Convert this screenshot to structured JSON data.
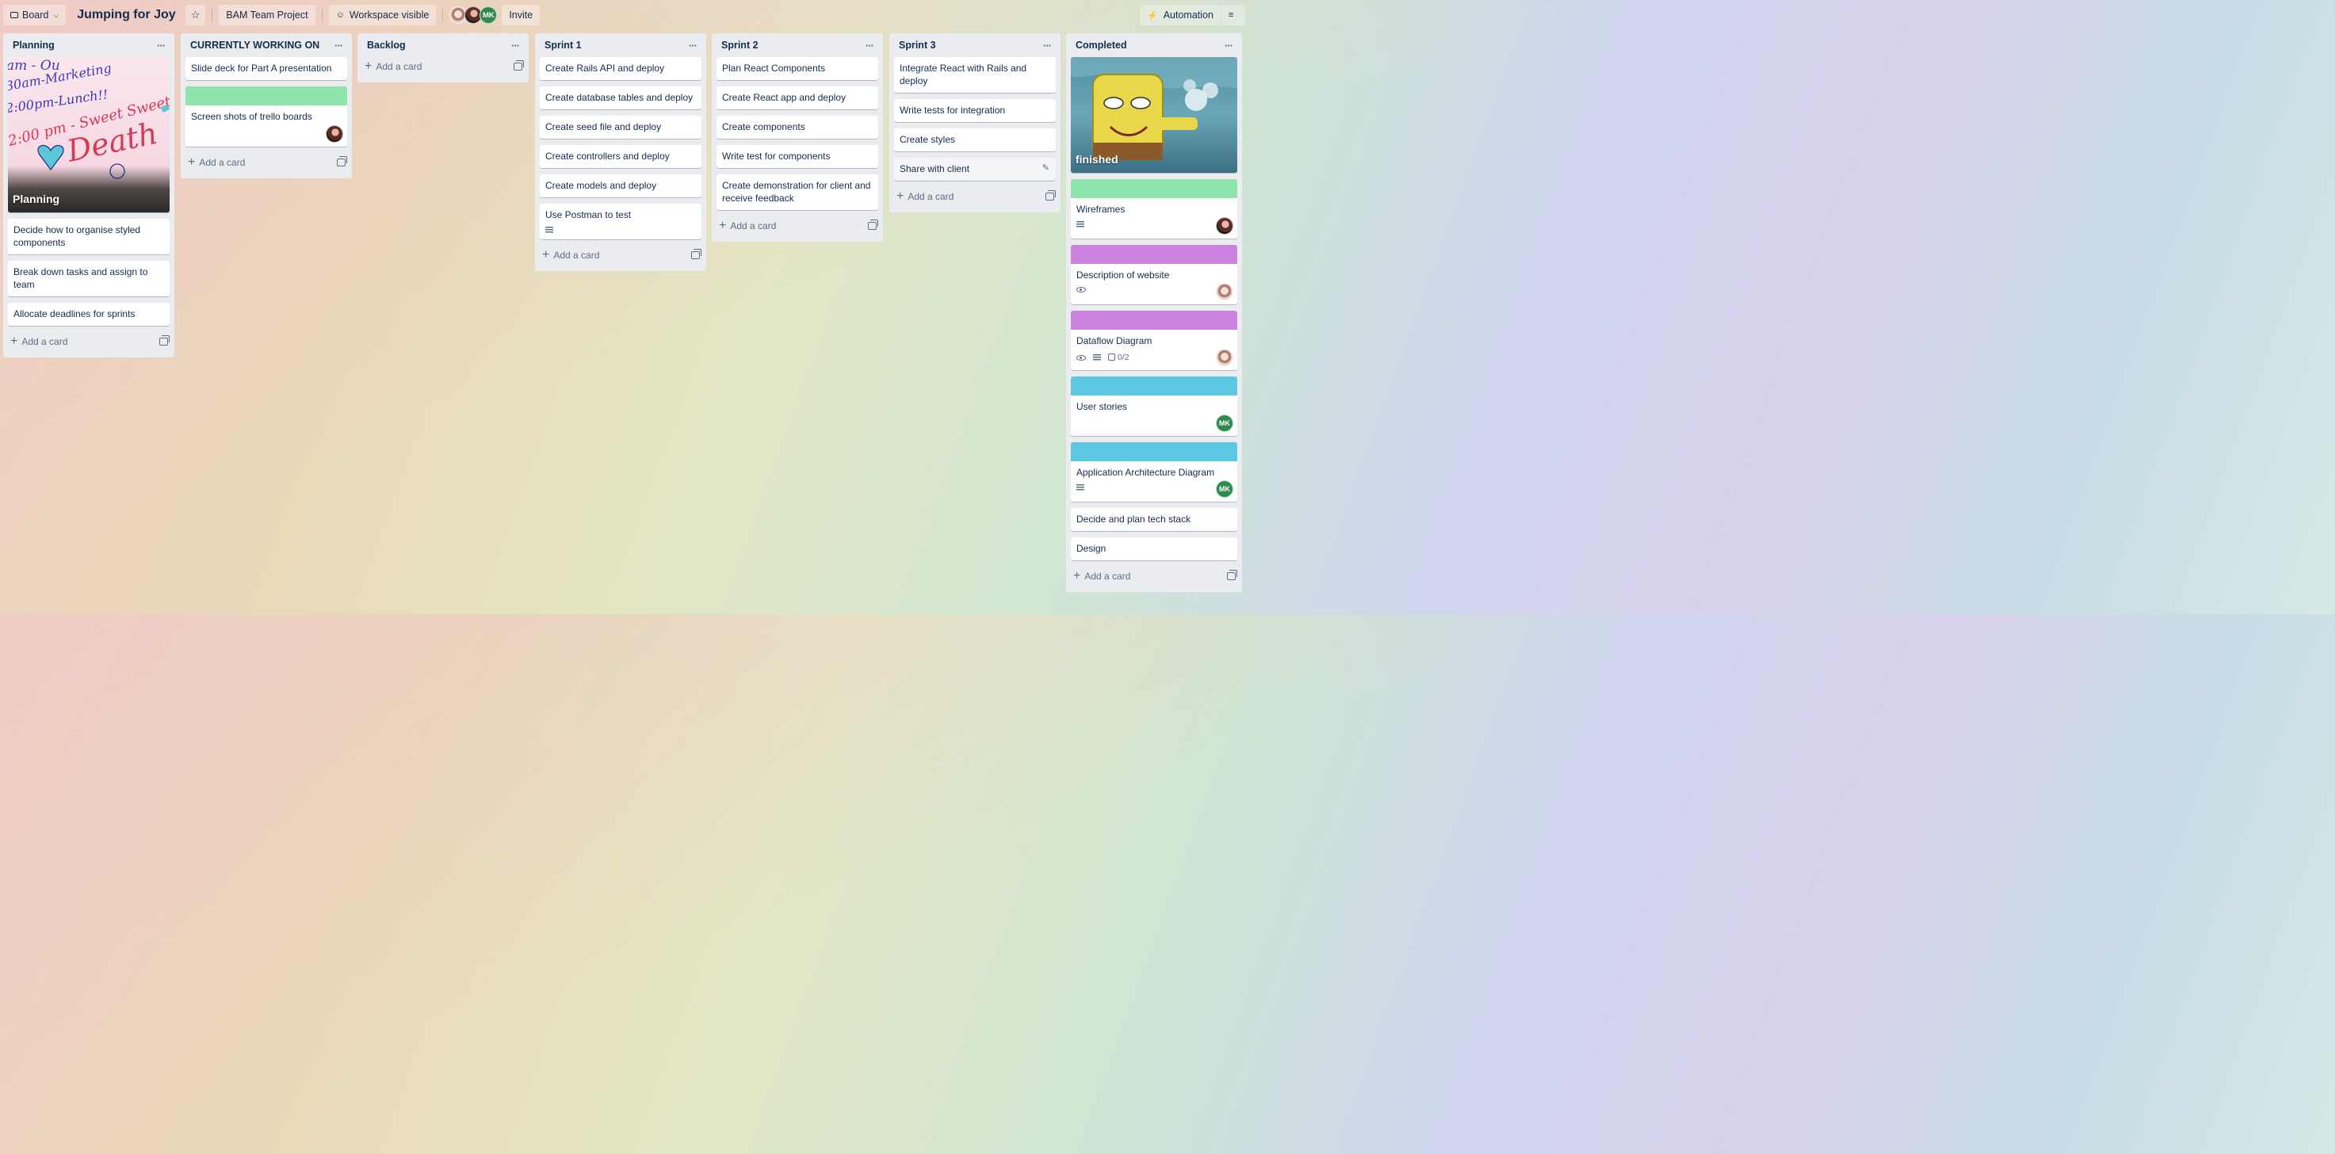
{
  "topbar": {
    "view_label": "Board",
    "board_title": "Jumping for Joy",
    "workspace": "BAM Team Project",
    "visibility": "Workspace visible",
    "invite_label": "Invite",
    "member_initials": "MK",
    "automation_label": "Automation"
  },
  "add_card_label": "Add a card",
  "lists": {
    "planning": {
      "name": "Planning",
      "cover_title": "Planning",
      "cover_handwriting": [
        "am - Ou",
        "30am-Marketing",
        "2:00pm-Lunch!!",
        "2:00 pm - Sweet Sweet",
        "Death"
      ],
      "cards": [
        "Decide how to organise styled components",
        "Break down tasks and assign to team",
        "Allocate deadlines for sprints"
      ]
    },
    "current": {
      "name": "CURRENTLY WORKING ON",
      "cards": [
        "Slide deck for Part A presentation",
        "Screen shots of trello boards"
      ]
    },
    "backlog": {
      "name": "Backlog"
    },
    "sprint1": {
      "name": "Sprint 1",
      "cards": [
        "Create Rails API and deploy",
        "Create database tables and deploy",
        "Create seed file and deploy",
        "Create controllers and deploy",
        "Create models and deploy",
        "Use Postman to test"
      ]
    },
    "sprint2": {
      "name": "Sprint 2",
      "cards": [
        "Plan React Components",
        "Create React app and deploy",
        "Create components",
        "Write test for components",
        "Create demonstration for client and receive feedback"
      ]
    },
    "sprint3": {
      "name": "Sprint 3",
      "cards": [
        "Integrate React with Rails and deploy",
        "Write tests for integration",
        "Create styles",
        "Share with client"
      ]
    },
    "completed": {
      "name": "Completed",
      "cover_title": "finished",
      "cards": [
        "Wireframes",
        "Description of website",
        "Dataflow Diagram",
        "User stories",
        "Application Architecture Diagram",
        "Decide and plan tech stack",
        "Design"
      ],
      "checklist": "0/2",
      "member_initials": "MK"
    }
  },
  "colors": {
    "green_label": "#8fe4ab",
    "purple_label": "#cc83e0",
    "blue_label": "#5bc7e1",
    "mk_avatar": "#2f8a4e"
  }
}
